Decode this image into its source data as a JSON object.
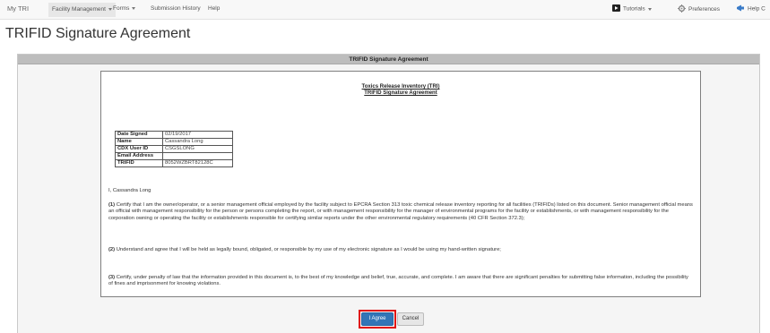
{
  "navbar": {
    "brand": "My TRI",
    "items": [
      {
        "label": "Facility Management",
        "dropdown": true
      },
      {
        "label": "Forms",
        "dropdown": true
      },
      {
        "label": "Submission History",
        "dropdown": false
      },
      {
        "label": "Help",
        "dropdown": false
      }
    ],
    "right": {
      "tutorials": "Tutorials",
      "preferences": "Preferences",
      "help": "Help C"
    }
  },
  "page": {
    "title": "TRIFID Signature Agreement"
  },
  "panel": {
    "header": "TRIFID Signature Agreement"
  },
  "document": {
    "title_line1": "Toxics Release Inventory (TRI)",
    "title_line2": "TRIFID Signature Agreement",
    "info_rows": [
      {
        "key": "Date Signed",
        "value": "02/19/2017"
      },
      {
        "key": "Name",
        "value": "Cassandra Long"
      },
      {
        "key": "CDX User ID",
        "value": "CSGSLONG"
      },
      {
        "key": "Email Address",
        "value": ""
      },
      {
        "key": "TRIFID",
        "value": "8052WZBRT82128C"
      }
    ],
    "intro": "I, Cassandra Long",
    "para1_num": "(1)",
    "para1_text": " Certify that I am the owner/operator, or a senior management official employed by the facility subject to EPCRA Section 313 toxic chemical release inventory reporting for all facilities (TRIFIDs) listed on this document. Senior management official means an official with management responsibility for the person or persons completing the report, or with management responsibility for the manager of environmental programs for the facility or establishments, or with management responsibility for the corporation owning or operating the facility or establishments responsible for certifying similar reports under the other environmental regulatory requirements (40 CFR Section 372.3);",
    "para2_num": "(2)",
    "para2_text": " Understand and agree that I will be held as legally bound, obligated, or responsible by my use of my electronic signature as I would be using my hand-written signature;",
    "para3_num": "(3)",
    "para3_text": " Certify, under penalty of law that the information provided in this document is, to the best of my knowledge and belief, true, accurate, and complete. I am aware that there are significant penalties for submitting false information, including the possibility of fines and imprisonment for knowing violations."
  },
  "buttons": {
    "agree": "I Agree",
    "cancel": "Cancel"
  },
  "colors": {
    "primary_button": "#3275b7",
    "highlight_border": "#e01010",
    "panel_header": "#bdbdbd"
  }
}
